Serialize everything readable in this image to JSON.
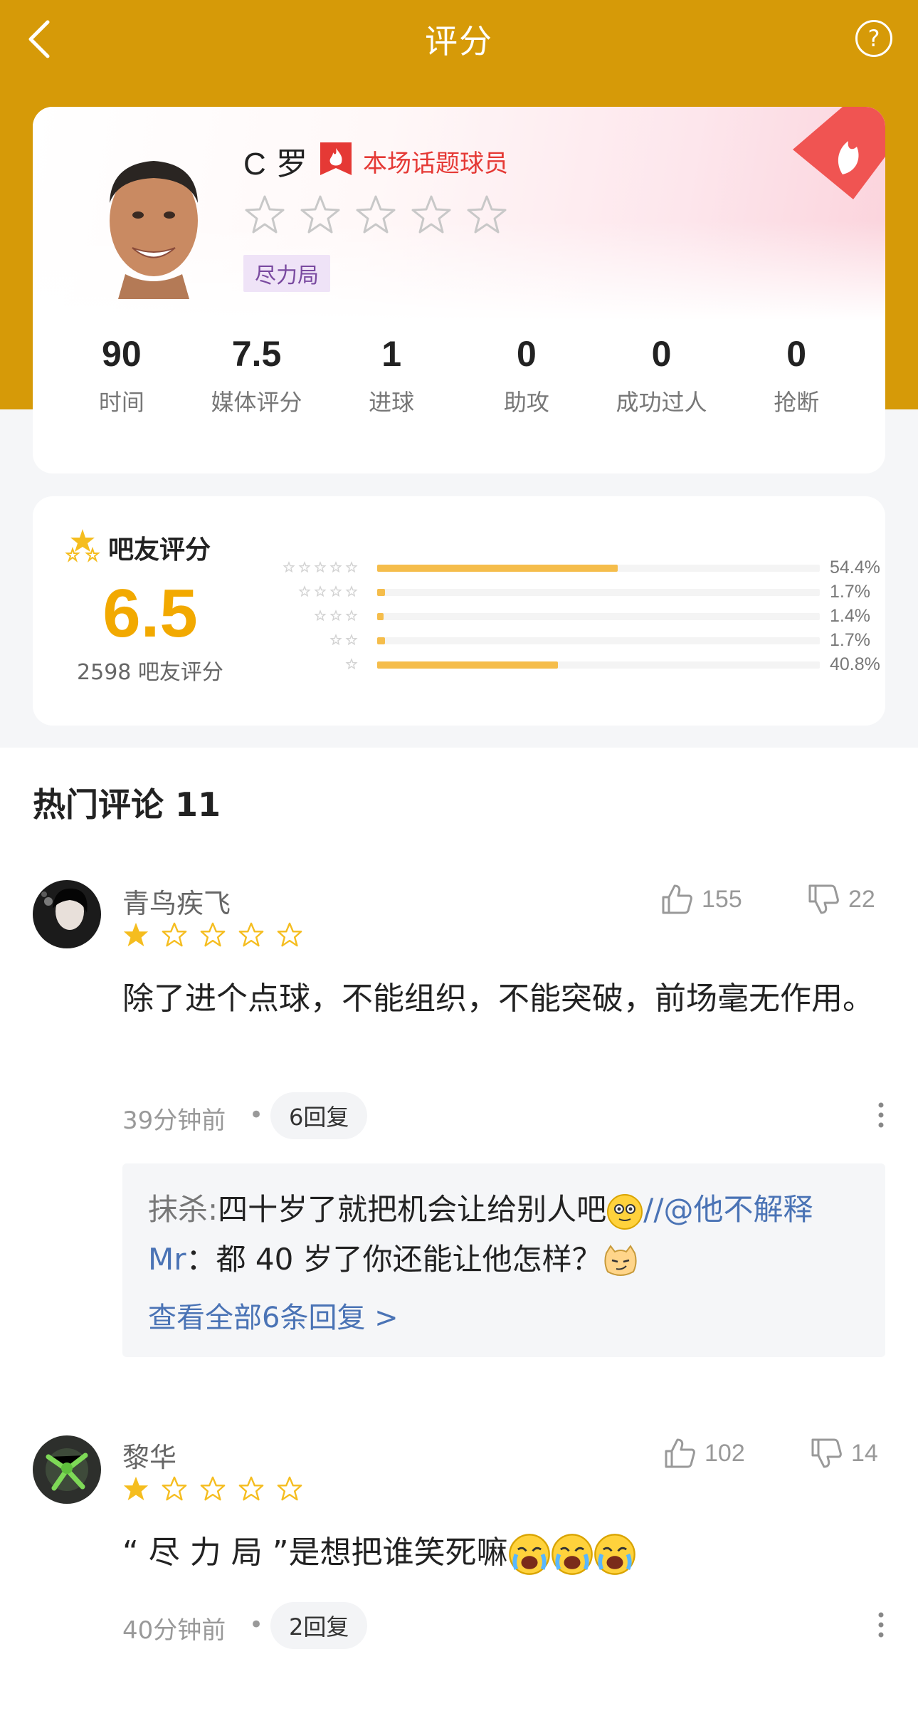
{
  "nav": {
    "title": "评分",
    "back_label": "返回",
    "help_label": "?"
  },
  "player": {
    "name": "C 罗",
    "hot_tag": "本场话题球员",
    "star_rating": 0,
    "tag": "尽力局",
    "stats": [
      {
        "value": "90",
        "label": "时间"
      },
      {
        "value": "7.5",
        "label": "媒体评分"
      },
      {
        "value": "1",
        "label": "进球"
      },
      {
        "value": "0",
        "label": "助攻"
      },
      {
        "value": "0",
        "label": "成功过人"
      },
      {
        "value": "0",
        "label": "抢断"
      }
    ]
  },
  "fan_rating": {
    "title": "吧友评分",
    "score": "6.5",
    "count_text": "2598 吧友评分",
    "distribution": [
      {
        "stars": 5,
        "percent": 54.4,
        "label": "54.4%"
      },
      {
        "stars": 4,
        "percent": 1.7,
        "label": "1.7%"
      },
      {
        "stars": 3,
        "percent": 1.4,
        "label": "1.4%"
      },
      {
        "stars": 2,
        "percent": 1.7,
        "label": "1.7%"
      },
      {
        "stars": 1,
        "percent": 40.8,
        "label": "40.8%"
      }
    ]
  },
  "comments_section": {
    "title": "热门评论 11",
    "comments": [
      {
        "user": "青鸟疾飞",
        "stars": 1,
        "likes": "155",
        "dislikes": "22",
        "text": "除了进个点球，不能组织，不能突破，前场毫无作用。",
        "time": "39分钟前",
        "replies": "6回复",
        "reply_preview": {
          "author": "抹杀:",
          "text_1": "四十岁了就把机会让给别人吧",
          "mention": "//@他不解释Mr",
          "text_2": "：都 40 岁了你还能让他怎样？",
          "view_all": "查看全部6条回复 >"
        }
      },
      {
        "user": "黎华",
        "stars": 1,
        "likes": "102",
        "dislikes": "14",
        "text": "“ 尽 力 局 ”是想把谁笑死嘛",
        "time": "40分钟前",
        "replies": "2回复"
      }
    ]
  },
  "colors": {
    "brand": "#d69a08",
    "score": "#f2a900",
    "bar": "#f5bd4b",
    "hot": "#e53935",
    "link": "#4a73b5"
  }
}
